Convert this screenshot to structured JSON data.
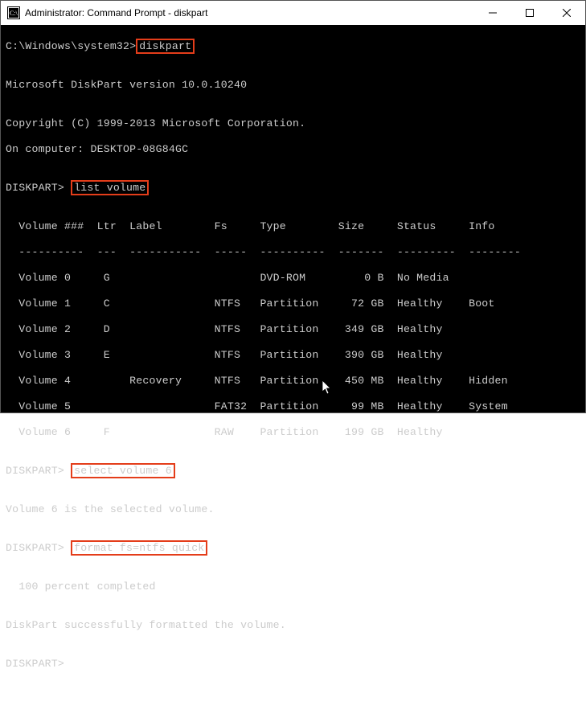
{
  "window": {
    "title": "Administrator: Command Prompt - diskpart"
  },
  "lines": {
    "prompt1_prefix": "C:\\Windows\\system32>",
    "cmd_diskpart": "diskpart",
    "blank": "",
    "version": "Microsoft DiskPart version 10.0.10240",
    "copyright": "Copyright (C) 1999-2013 Microsoft Corporation.",
    "computer": "On computer: DESKTOP-08G84GC",
    "dp_prompt": "DISKPART> ",
    "cmd_list_volume": "list volume",
    "header": "  Volume ###  Ltr  Label        Fs     Type        Size     Status     Info",
    "divider": "  ----------  ---  -----------  -----  ----------  -------  ---------  --------",
    "vol0": "  Volume 0     G                       DVD-ROM         0 B  No Media",
    "vol1": "  Volume 1     C                NTFS   Partition     72 GB  Healthy    Boot",
    "vol2": "  Volume 2     D                NTFS   Partition    349 GB  Healthy",
    "vol3": "  Volume 3     E                NTFS   Partition    390 GB  Healthy",
    "vol4": "  Volume 4         Recovery     NTFS   Partition    450 MB  Healthy    Hidden",
    "vol5": "  Volume 5                      FAT32  Partition     99 MB  Healthy    System",
    "vol6": "  Volume 6     F                RAW    Partition    199 GB  Healthy",
    "cmd_select": "select volume 6",
    "selected_msg": "Volume 6 is the selected volume.",
    "cmd_format": "format fs=ntfs quick",
    "progress": "  100 percent completed",
    "success": "DiskPart successfully formatted the volume."
  },
  "chart_data": {
    "type": "table",
    "title": "DISKPART list volume",
    "columns": [
      "Volume ###",
      "Ltr",
      "Label",
      "Fs",
      "Type",
      "Size",
      "Status",
      "Info"
    ],
    "rows": [
      [
        "Volume 0",
        "G",
        "",
        "",
        "DVD-ROM",
        "0 B",
        "No Media",
        ""
      ],
      [
        "Volume 1",
        "C",
        "",
        "NTFS",
        "Partition",
        "72 GB",
        "Healthy",
        "Boot"
      ],
      [
        "Volume 2",
        "D",
        "",
        "NTFS",
        "Partition",
        "349 GB",
        "Healthy",
        ""
      ],
      [
        "Volume 3",
        "E",
        "",
        "NTFS",
        "Partition",
        "390 GB",
        "Healthy",
        ""
      ],
      [
        "Volume 4",
        "",
        "Recovery",
        "NTFS",
        "Partition",
        "450 MB",
        "Healthy",
        "Hidden"
      ],
      [
        "Volume 5",
        "",
        "",
        "FAT32",
        "Partition",
        "99 MB",
        "Healthy",
        "System"
      ],
      [
        "Volume 6",
        "F",
        "",
        "RAW",
        "Partition",
        "199 GB",
        "Healthy",
        ""
      ]
    ]
  }
}
